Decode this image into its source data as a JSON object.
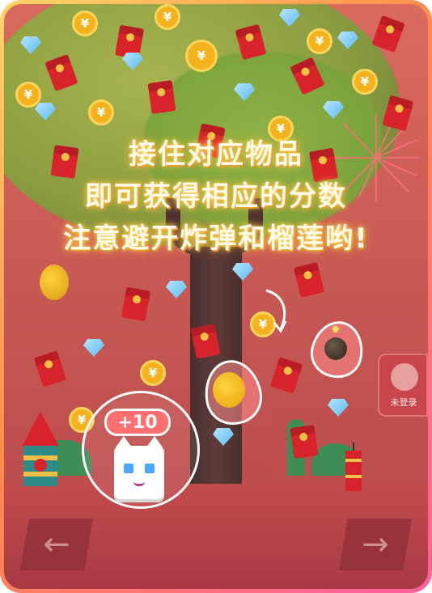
{
  "instruction": {
    "line1": "接住对应物品",
    "line2": "即可获得相应的分数",
    "line3": "注意避开炸弹和榴莲哟!"
  },
  "score_badge": "+10",
  "login_label": "未登录",
  "coin_symbol": "¥",
  "controls": {
    "left_arrow": "←",
    "right_arrow": "→"
  },
  "colors": {
    "background": "#c75a55",
    "envelope": "#d9232b",
    "coin": "#f4b21c",
    "text_glow": "#ffd95a"
  }
}
